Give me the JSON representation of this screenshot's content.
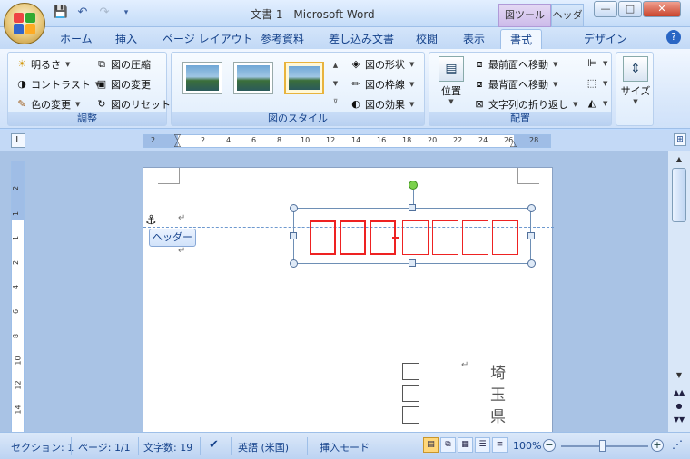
{
  "title_bar": {
    "title": "文書 1 - Microsoft Word",
    "context_tab_picture": "図ツール",
    "context_tab_header": "ヘッダー",
    "min": "—",
    "max": "□",
    "close": "✕"
  },
  "qat": {
    "save": "💾",
    "undo": "↶",
    "redo": "↷",
    "customize": "▾"
  },
  "tabs": [
    "ホーム",
    "挿入",
    "ページ レイアウト",
    "参考資料",
    "差し込み文書",
    "校閲",
    "表示",
    "書式",
    "デザイン"
  ],
  "ribbon": {
    "adjust": {
      "label": "調整",
      "brightness": "明るさ",
      "contrast": "コントラスト",
      "recolor": "色の変更",
      "compress": "図の圧縮",
      "change_picture": "図の変更",
      "reset_picture": "図のリセット"
    },
    "styles": {
      "label": "図のスタイル",
      "shape": "図の形状",
      "border": "図の枠線",
      "effects": "図の効果"
    },
    "arrange": {
      "label": "配置",
      "position": "位置",
      "bring_front": "最前面へ移動",
      "send_back": "最背面へ移動",
      "text_wrap": "文字列の折り返し"
    },
    "size": {
      "label": "サイズ"
    }
  },
  "ruler": {
    "ticks": [
      "2",
      "2",
      "4",
      "6",
      "8",
      "10",
      "12",
      "14",
      "16",
      "18",
      "20",
      "22",
      "24",
      "26",
      "28"
    ],
    "vticks": [
      "2",
      "1",
      "1",
      "2",
      "4",
      "6",
      "8",
      "10",
      "12",
      "14"
    ]
  },
  "document": {
    "header_tag": "ヘッダー",
    "vertical_text": "埼玉県"
  },
  "status": {
    "section": "セクション: 1",
    "page": "ページ: 1/1",
    "words": "文字数: 19",
    "language": "英語 (米国)",
    "mode": "挿入モード",
    "zoom": "100%"
  },
  "colors": {
    "accent_red": "#e22222",
    "ribbon_blue": "#15428b",
    "rotate_handle": "#7bd14c"
  }
}
